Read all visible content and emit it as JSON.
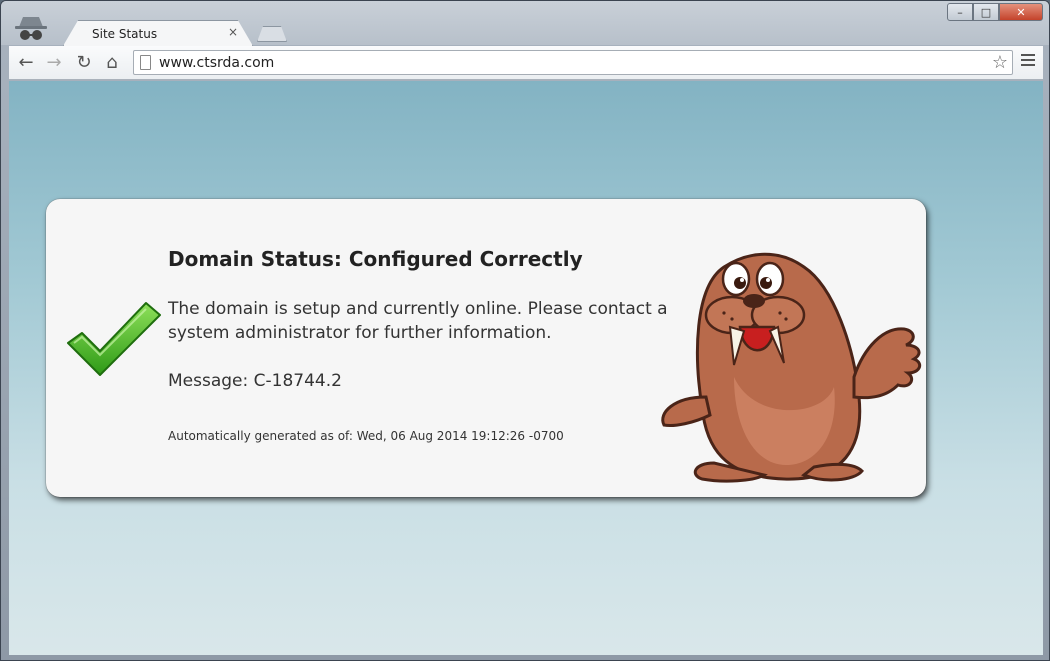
{
  "browser": {
    "tab_title": "Site Status",
    "tab_close": "×",
    "url": "www.ctsrda.com",
    "window_buttons": {
      "minimize": "–",
      "maximize": "□",
      "close": "✕"
    },
    "nav": {
      "back": "←",
      "forward": "→",
      "reload": "↻",
      "home": "⌂",
      "star": "☆"
    },
    "icons": [
      "incognito-icon",
      "back-icon",
      "forward-icon",
      "reload-icon",
      "home-icon",
      "page-icon",
      "star-icon",
      "menu-icon"
    ]
  },
  "status_card": {
    "title": "Domain Status: Configured Correctly",
    "body": "The domain is setup and currently online. Please contact a system administrator for further information.",
    "message": "Message: C-18744.2",
    "generated": "Automatically generated as of: Wed, 06 Aug 2014 19:12:26 -0700"
  },
  "colors": {
    "check_green": "#3fae1f",
    "walrus_brown": "#b86a4b",
    "close_red": "#c4432b"
  }
}
